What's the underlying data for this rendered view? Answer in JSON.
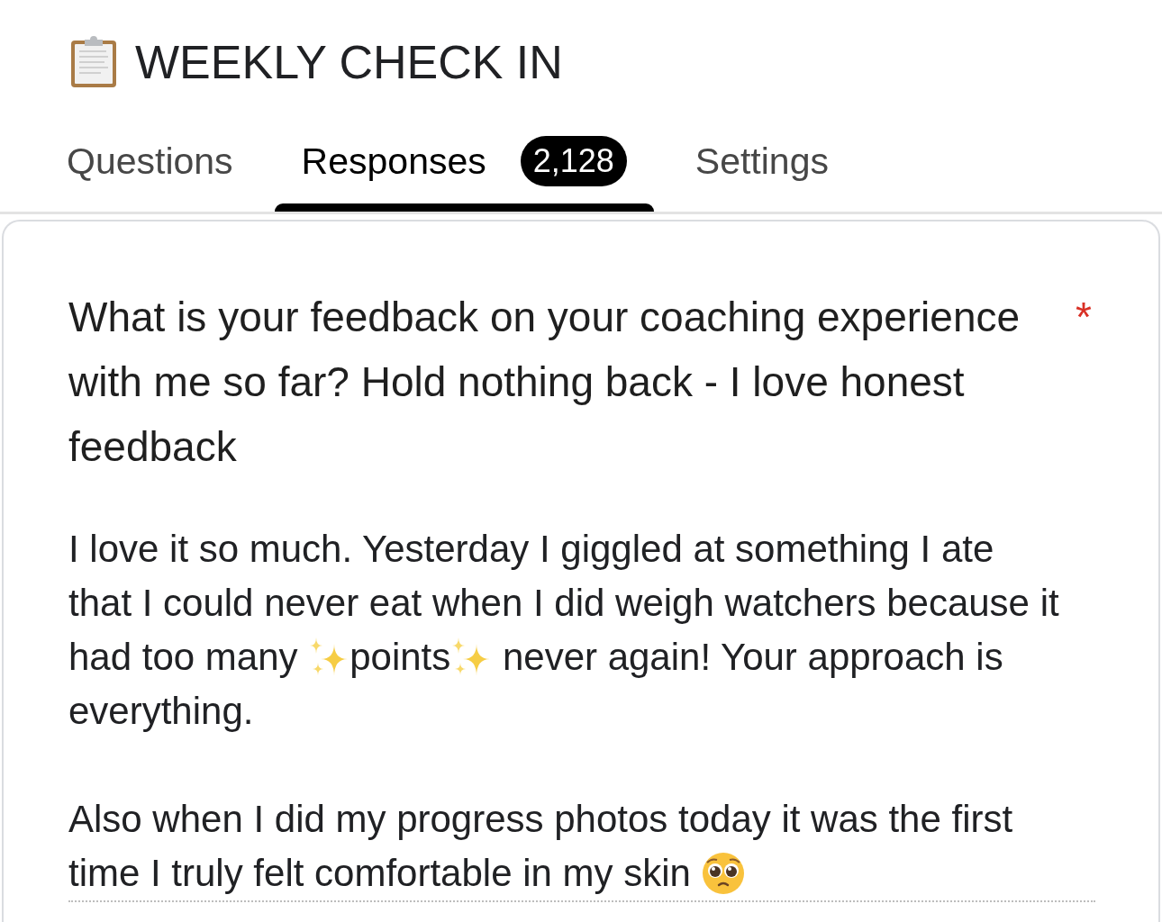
{
  "form_title": "WEEKLY CHECK IN",
  "tabs": [
    {
      "label": "Questions",
      "selected": false
    },
    {
      "label": "Responses",
      "selected": true,
      "count": "2,128"
    },
    {
      "label": "Settings",
      "selected": false
    }
  ],
  "question": {
    "text": "What is your feedback on your coaching experience with me so far? Hold nothing back - I love honest feedback",
    "required_mark": "*"
  },
  "answer": {
    "paragraphs": [
      {
        "parts": [
          {
            "kind": "text",
            "text": "I love it so much. Yesterday I giggled at something I ate that I could never eat when I did weigh watchers because it had too many "
          },
          {
            "kind": "sparkles"
          },
          {
            "kind": "text",
            "text": "points"
          },
          {
            "kind": "sparkles"
          },
          {
            "kind": "text",
            "text": " never again! Your approach is everything."
          }
        ]
      },
      {
        "parts": [
          {
            "kind": "text",
            "text": "Also when I did my progress photos today it was the first time I truly felt comfortable in my skin "
          },
          {
            "kind": "pleading-face"
          }
        ]
      }
    ]
  }
}
